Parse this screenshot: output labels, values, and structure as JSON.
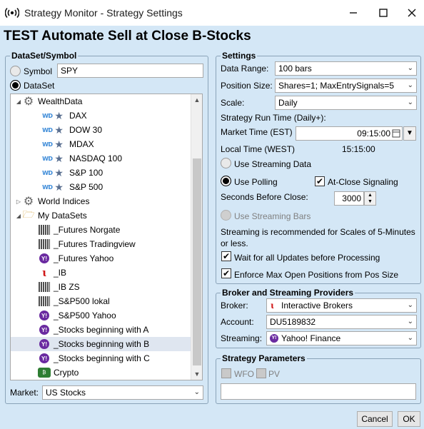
{
  "window": {
    "title": "Strategy Monitor - Strategy Settings",
    "icon": "broadcast-icon",
    "controls": [
      "minimize-icon",
      "maximize-icon",
      "close-icon"
    ]
  },
  "heading": "TEST Automate Sell at Close B-Stocks",
  "dataset": {
    "group_title": "DataSet/Symbol",
    "symbol_label": "Symbol",
    "symbol_value": "SPY",
    "dataset_label": "DataSet",
    "selected_mode": "DataSet",
    "tree": [
      {
        "label": "WealthData",
        "icon": "gear-icon",
        "level": 0,
        "expander": "◢"
      },
      {
        "label": "DAX",
        "icon": "wd-star-icon",
        "level": 1
      },
      {
        "label": "DOW 30",
        "icon": "wd-star-icon",
        "level": 1
      },
      {
        "label": "MDAX",
        "icon": "wd-star-icon",
        "level": 1
      },
      {
        "label": "NASDAQ 100",
        "icon": "wd-star-icon",
        "level": 1
      },
      {
        "label": "S&P 100",
        "icon": "wd-star-icon",
        "level": 1
      },
      {
        "label": "S&P 500",
        "icon": "wd-star-icon",
        "level": 1
      },
      {
        "label": "World Indices",
        "icon": "gear-icon",
        "level": 0,
        "expander": "▷"
      },
      {
        "label": "My DataSets",
        "icon": "folder-icon",
        "level": 0,
        "expander": "◢"
      },
      {
        "label": "_Futures Norgate",
        "icon": "grid-icon",
        "level": 1
      },
      {
        "label": "_Futures Tradingview",
        "icon": "grid-icon",
        "level": 1
      },
      {
        "label": "_Futures Yahoo",
        "icon": "yahoo-icon",
        "level": 1
      },
      {
        "label": "_IB",
        "icon": "ib-icon",
        "level": 1
      },
      {
        "label": "_IB ZS",
        "icon": "grid-icon",
        "level": 1
      },
      {
        "label": "_S&P500 lokal",
        "icon": "grid-icon",
        "level": 1
      },
      {
        "label": "_S&P500 Yahoo",
        "icon": "yahoo-icon",
        "level": 1
      },
      {
        "label": "_Stocks beginning with A",
        "icon": "yahoo-icon",
        "level": 1
      },
      {
        "label": "_Stocks beginning with B",
        "icon": "yahoo-icon",
        "level": 1,
        "selected": true
      },
      {
        "label": "_Stocks beginning with C",
        "icon": "yahoo-icon",
        "level": 1
      },
      {
        "label": "Crypto",
        "icon": "crypto-icon",
        "level": 1
      }
    ],
    "market_label": "Market:",
    "market_value": "US Stocks"
  },
  "settings": {
    "group_title": "Settings",
    "data_range_label": "Data Range:",
    "data_range_value": "100 bars",
    "position_size_label": "Position Size:",
    "position_size_value": "Shares=1; MaxEntrySignals=5",
    "scale_label": "Scale:",
    "scale_value": "Daily",
    "run_time_label": "Strategy Run Time (Daily+):",
    "market_time_label": "Market Time (EST)",
    "market_time_value": "09:15:00",
    "local_time_label": "Local Time (WEST)",
    "local_time_value": "15:15:00",
    "use_streaming_data": "Use Streaming Data",
    "use_polling": "Use Polling",
    "at_close_signaling": "At-Close Signaling",
    "seconds_before_close_label": "Seconds Before Close:",
    "seconds_before_close_value": "3000",
    "use_streaming_bars": "Use Streaming Bars",
    "streaming_note": "Streaming is recommended for Scales of 5-Minutes or less.",
    "wait_for_updates": "Wait for all Updates before Processing",
    "enforce_max_open": "Enforce Max Open Positions from Pos Size"
  },
  "broker": {
    "group_title": "Broker and Streaming Providers",
    "broker_label": "Broker:",
    "broker_value": "Interactive Brokers",
    "account_label": "Account:",
    "account_value": "DU5189832",
    "streaming_label": "Streaming:",
    "streaming_value": "Yahoo! Finance"
  },
  "params": {
    "group_title": "Strategy Parameters",
    "wfo_label": "WFO",
    "pv_label": "PV"
  },
  "footer": {
    "cancel_label": "Cancel",
    "ok_label": "OK"
  },
  "colors": {
    "background": "#d4e7f6",
    "ib_red": "#d01818",
    "yahoo_purple": "#6a2aa0",
    "wd_blue": "#3b8ad8"
  }
}
